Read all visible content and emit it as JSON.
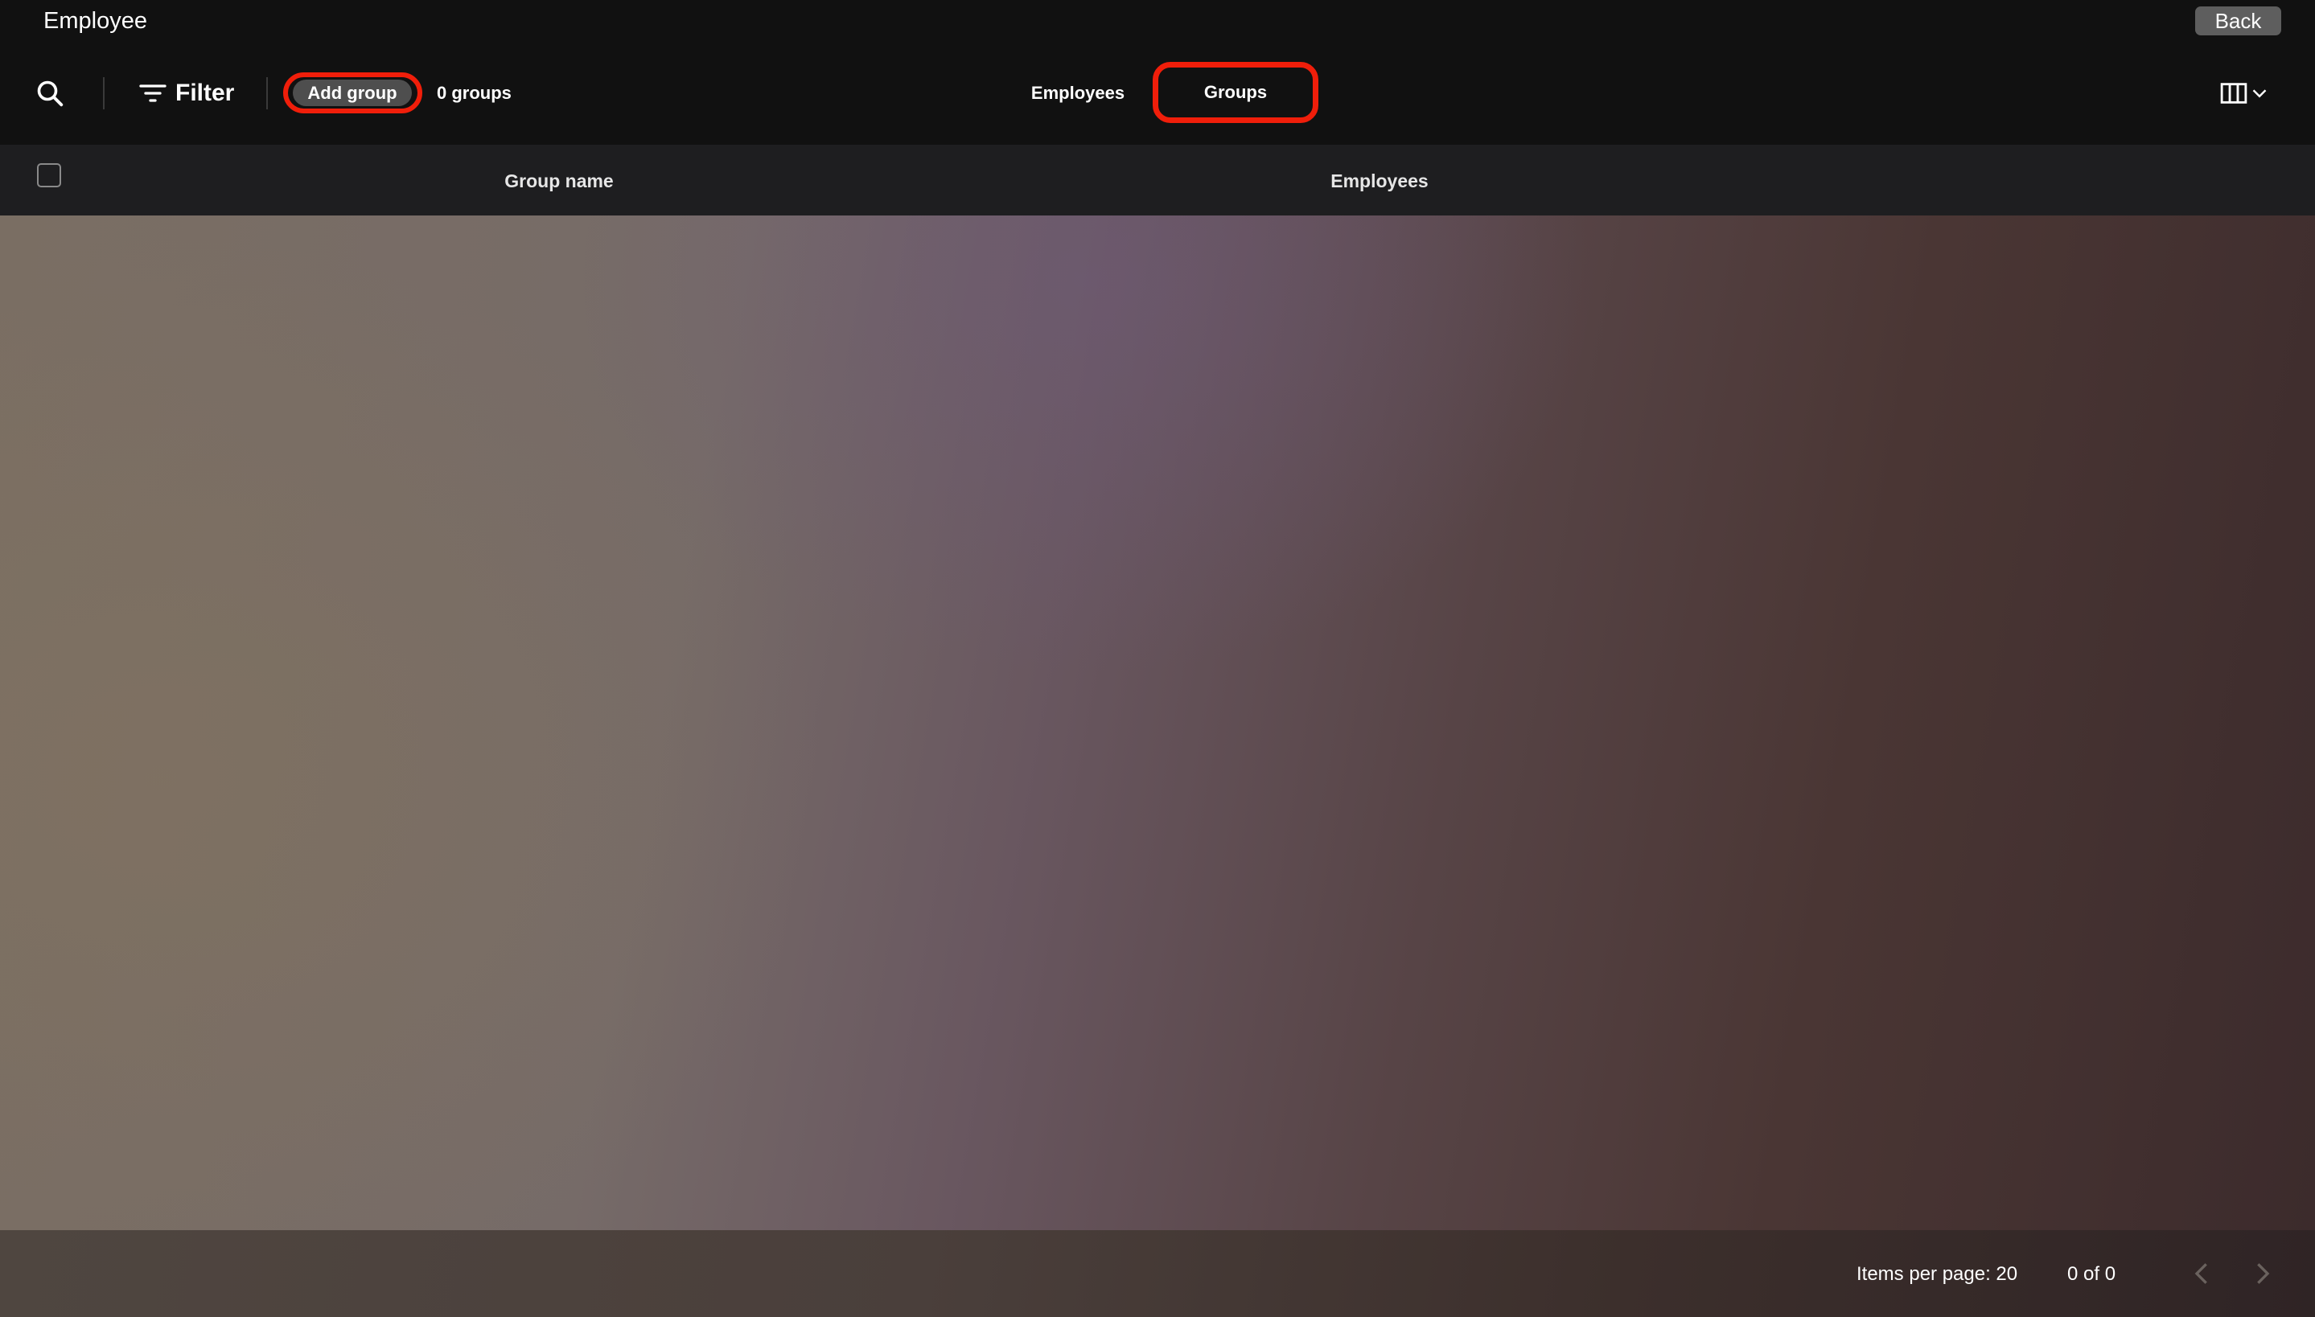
{
  "app": {
    "title": "Employee",
    "back_label": "Back"
  },
  "toolbar": {
    "search_icon": "search-icon",
    "filter_label": "Filter",
    "add_group_label": "Add group",
    "group_count": "0 groups",
    "tabs": [
      {
        "label": "Employees",
        "active": false
      },
      {
        "label": "Groups",
        "active": true
      }
    ],
    "columns_icon": "columns-icon"
  },
  "table": {
    "columns": [
      "Group name",
      "Employees"
    ],
    "rows": []
  },
  "paginator": {
    "items_per_page": "Items per page: 20",
    "range": "0 of 0"
  },
  "colors": {
    "background": "#111111",
    "header_bg": "#1e1e20",
    "highlight_ring": "#f01e0a",
    "button_bg": "#4e4e4e"
  }
}
